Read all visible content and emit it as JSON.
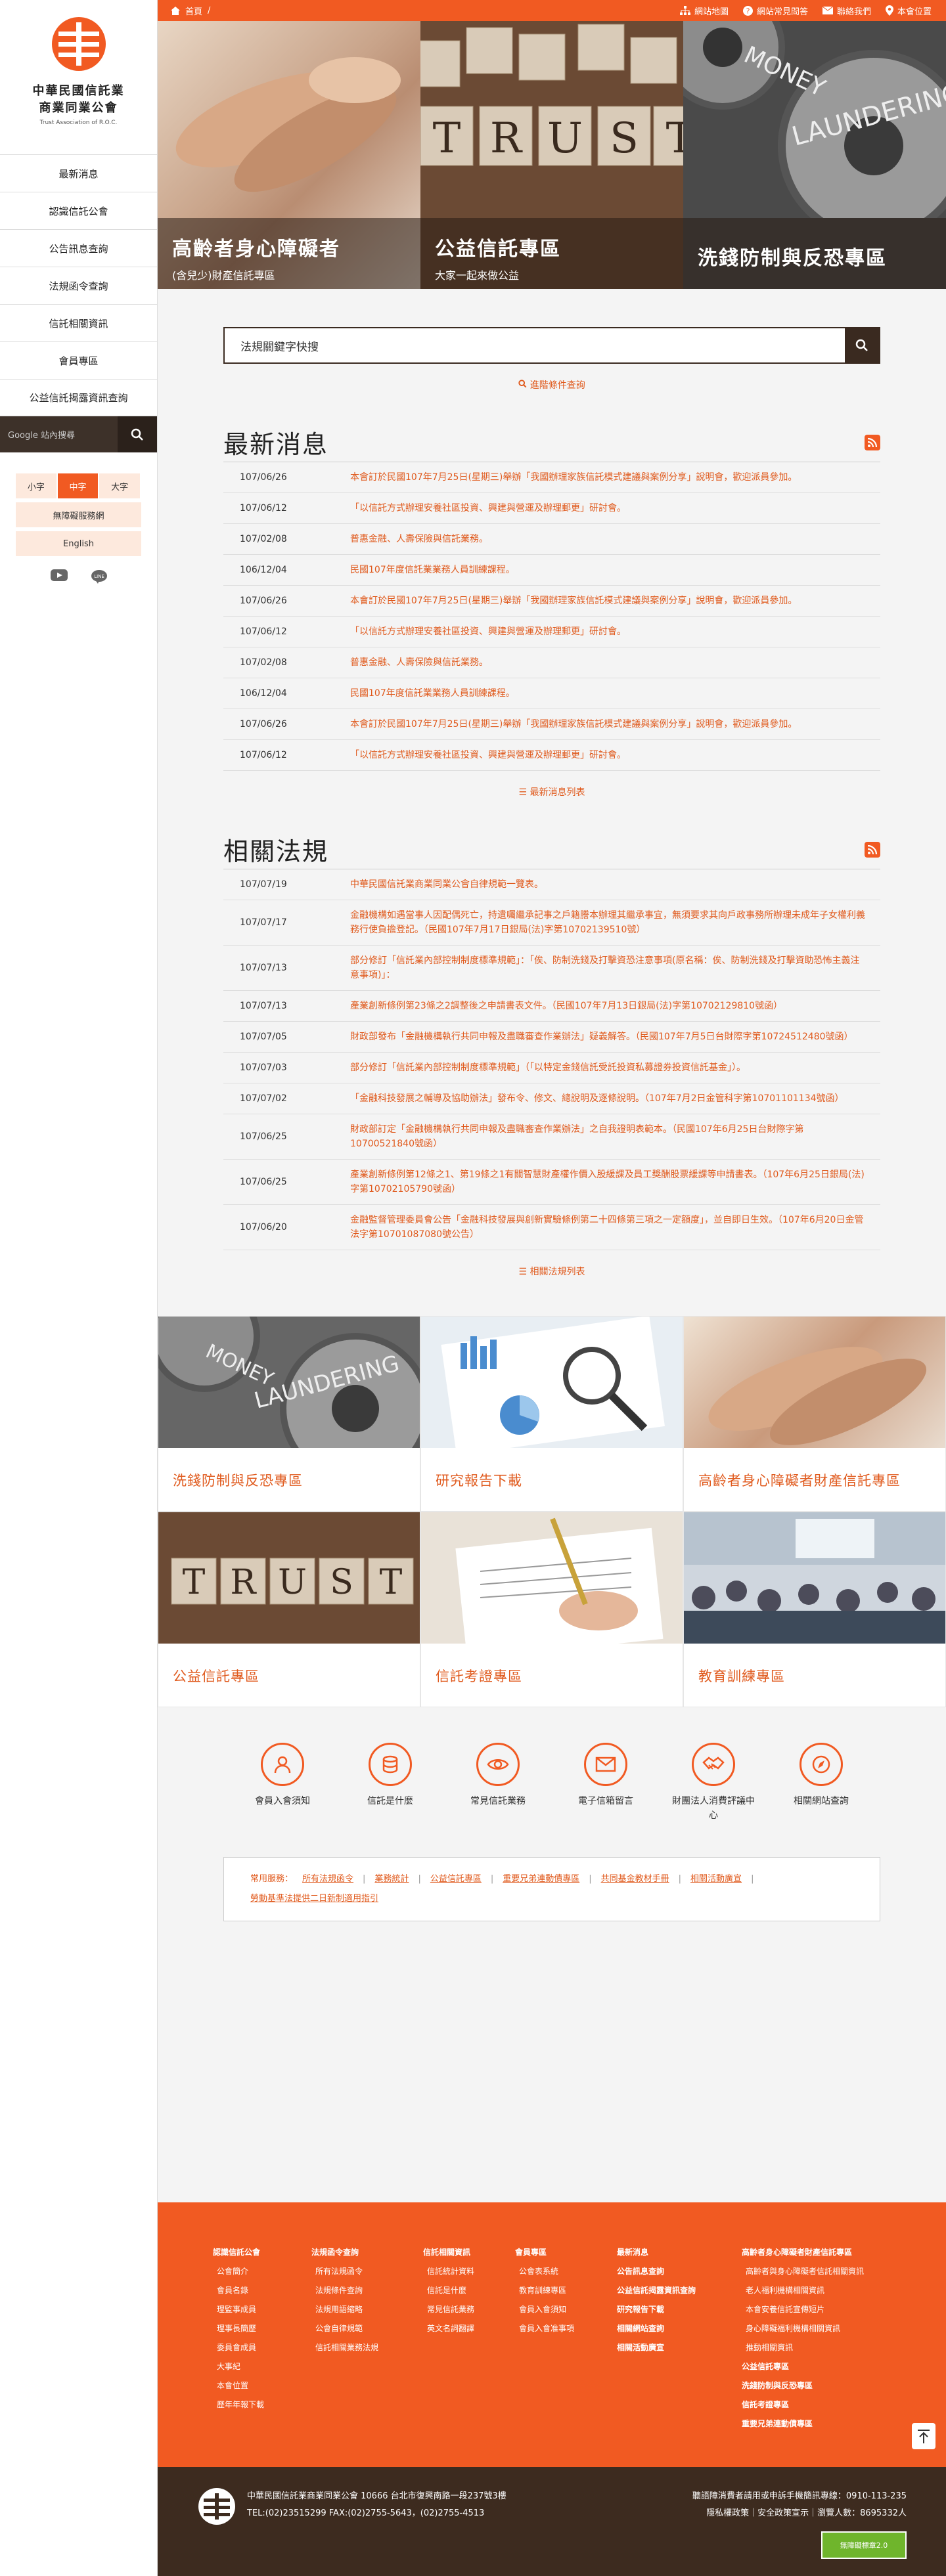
{
  "site": {
    "name_line1": "中華民國信託業",
    "name_line2": "商業同業公會",
    "name_en": "Trust Association of R.O.C."
  },
  "nav": [
    "最新消息",
    "認識信託公會",
    "公告訊息查詢",
    "法規函令查詢",
    "信託相關資訊",
    "會員專區",
    "公益信託揭露資訊查詢"
  ],
  "gsearch": {
    "placeholder": "Google 站內搜尋"
  },
  "font_sizes": [
    "小字",
    "中字",
    "大字"
  ],
  "side_buttons": [
    "無障礙服務網",
    "English"
  ],
  "topbar": {
    "home": "首頁",
    "sep": "/",
    "links": [
      "網站地圖",
      "網站常見問答",
      "聯絡我們",
      "本會位置"
    ]
  },
  "banners": [
    {
      "title": "高齡者身心障礙者",
      "sub": "(含兒少)財產信託專區"
    },
    {
      "title": "公益信託專區",
      "sub": "大家一起來做公益"
    },
    {
      "title": "洗錢防制與反恐專區",
      "sub": ""
    }
  ],
  "search": {
    "placeholder": "法規關鍵字快搜"
  },
  "advanced": "進階條件查詢",
  "news": {
    "title": "最新消息",
    "more": "最新消息列表",
    "items": [
      {
        "d": "107/06/26",
        "t": "本會訂於民國107年7月25日(星期三)舉辦「我國辦理家族信託模式建議與案例分享」說明會，歡迎派員參加。"
      },
      {
        "d": "107/06/12",
        "t": "「以信託方式辦理安養社區投資、興建與營運及辦理郵更」研討會。"
      },
      {
        "d": "107/02/08",
        "t": "普惠金融、人壽保險與信託業務。"
      },
      {
        "d": "106/12/04",
        "t": "民國107年度信託業業務人員訓練課程。"
      },
      {
        "d": "107/06/26",
        "t": "本會訂於民國107年7月25日(星期三)舉辦「我國辦理家族信託模式建議與案例分享」說明會，歡迎派員參加。"
      },
      {
        "d": "107/06/12",
        "t": "「以信託方式辦理安養社區投資、興建與營運及辦理郵更」研討會。"
      },
      {
        "d": "107/02/08",
        "t": "普惠金融、人壽保險與信託業務。"
      },
      {
        "d": "106/12/04",
        "t": "民國107年度信託業業務人員訓練課程。"
      },
      {
        "d": "107/06/26",
        "t": "本會訂於民國107年7月25日(星期三)舉辦「我國辦理家族信託模式建議與案例分享」說明會，歡迎派員參加。"
      },
      {
        "d": "107/06/12",
        "t": "「以信託方式辦理安養社區投資、興建與營運及辦理郵更」研討會。"
      }
    ]
  },
  "laws": {
    "title": "相關法規",
    "more": "相關法規列表",
    "items": [
      {
        "d": "107/07/19",
        "t": "中華民國信託業商業同業公會自律規範一覽表。"
      },
      {
        "d": "107/07/17",
        "t": "金融機構如遇當事人因配偶死亡，持遺囑繼承記事之戶籍謄本辦理其繼承事宜，無須要求其向戶政事務所辦理未成年子女權利義務行使負擔登記。（民國107年7月17日銀局(法)字第10702139510號）"
      },
      {
        "d": "107/07/13",
        "t": "部分修訂「信託業內部控制制度標準規範」：「俟、防制洗錢及打擊資恐注意事項(原名稱：俟、防制洗錢及打擊資助恐怖主義注意事項)」："
      },
      {
        "d": "107/07/13",
        "t": "產業創新條例第23條之2調整後之申請書表文件。（民國107年7月13日銀局(法)字第10702129810號函）"
      },
      {
        "d": "107/07/05",
        "t": "財政部發布「金融機構執行共同申報及盡職審查作業辦法」疑義解答。（民國107年7月5日台財際字第10724512480號函）"
      },
      {
        "d": "107/07/03",
        "t": "部分修訂「信託業內部控制制度標準規範」（「以特定金錢信託受託投資私募證券投資信託基金」）。"
      },
      {
        "d": "107/07/02",
        "t": "「金融科技發展之輔導及協助辦法」發布令、修文、總說明及逐條說明。（107年7月2日金管科字第10701101134號函）"
      },
      {
        "d": "107/06/25",
        "t": "財政部訂定「金融機構執行共同申報及盡職審查作業辦法」之自我證明表範本。（民國107年6月25日台財際字第10700521840號函）"
      },
      {
        "d": "107/06/25",
        "t": "產業創新條例第12條之1、第19條之1有關智慧財產權作價入股緩課及員工獎酬股票緩課等申請書表。（107年6月25日銀局(法)字第10702105790號函）"
      },
      {
        "d": "107/06/20",
        "t": "金融監督管理委員會公告「金融科技發展與創新實驗條例第二十四條第三項之一定額度」，並自即日生效。（107年6月20日金管法字第10701087080號公告）"
      }
    ]
  },
  "cards": [
    "洗錢防制與反恐專區",
    "研究報告下載",
    "高齡者身心障礙者財產信託專區",
    "公益信託專區",
    "信託考證專區",
    "教育訓練專區"
  ],
  "shortcuts": [
    "會員入會須知",
    "信託是什麼",
    "常見信託業務",
    "電子信箱留言",
    "財團法人消費評議中心",
    "相關網站查詢"
  ],
  "quick": {
    "label": "常用服務：",
    "links": [
      "所有法規函令",
      "業務統計",
      "公益信託專區",
      "重要兄弟連動債專區",
      "共同基金教材手冊",
      "相關活動廣宣",
      "勞動基準法提供二日新制適用指引"
    ]
  },
  "footer_cols": [
    {
      "h": "認識信託公會",
      "items": [
        "公會簡介",
        "會員名錄",
        "理監事成員",
        "理事長簡歷",
        "委員會成員",
        "大事紀",
        "本會位置",
        "歷年年報下載"
      ]
    },
    {
      "h": "法規函令查詢",
      "items": [
        "所有法規函令",
        "法規條件查詢",
        "法規用語縮略",
        "公會自律規範",
        "信託相關業務法規"
      ]
    },
    {
      "h": "信託相關資訊",
      "items": [
        "信託統計資料",
        "信託是什麼",
        "常見信託業務",
        "英文名詞翻譯"
      ]
    },
    {
      "h": "會員專區",
      "items": [
        "公會表系統",
        "教育訓練專區",
        "會員入會須知",
        "會員入會准事項"
      ]
    },
    {
      "h": "最新消息",
      "items": []
    },
    {
      "h": "高齡者身心障礙者財產信託專區",
      "items": []
    }
  ],
  "footer_col5": [
    "公告訊息查詢",
    "公益信託揭露資訊查詢",
    "研究報告下載",
    "相關網站查詢",
    "相關活動廣宣"
  ],
  "footer_col6": [
    "高齡者與身心障礙者信託相關資訊",
    "老人福利機構相關資訊",
    "本會安養信託宣傳短片",
    "身心障礙福利機構相關資訊",
    "推動相關資訊"
  ],
  "footer_col6b": [
    "公益信託專區",
    "洗錢防制與反恐專區",
    "信託考證專區",
    "重要兄弟連動債專區"
  ],
  "bottom": {
    "line1": "中華民國信託業商業同業公會 10666 台北市復興南路一段237號3樓",
    "line2": "TEL:(02)23515299  FAX:(02)2755-5643，(02)2755-4513",
    "right1": "聽語障消費者請用或申訴手機簡訊專線：0910-113-235",
    "right2": "隱私權政策｜安全政策宣示｜瀏覽人數：8695332人",
    "badge": "無障礙標章2.0"
  }
}
